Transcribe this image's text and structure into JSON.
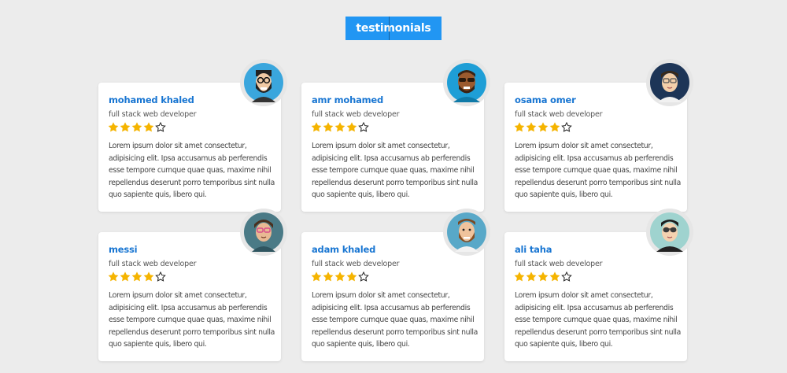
{
  "section_title": "testimonials",
  "star_color": "#f5b400",
  "accent_color": "#2196f3",
  "testimonials": [
    {
      "name": "mohamed khaled",
      "role": "full stack web developer",
      "rating": 4,
      "max_rating": 5,
      "avatar_icon": "avatar-beard-glasses-icon",
      "text": "Lorem ipsum dolor sit amet consectetur, adipisicing elit. Ipsa accusamus ab perferendis esse tempore cumque quae quas, maxime nihil repellendus deserunt porro temporibus sint nulla quo sapiente quis, libero qui."
    },
    {
      "name": "amr mohamed",
      "role": "full stack web developer",
      "rating": 4,
      "max_rating": 5,
      "avatar_icon": "avatar-sunglasses-icon",
      "text": "Lorem ipsum dolor sit amet consectetur, adipisicing elit. Ipsa accusamus ab perferendis esse tempore cumque quae quas, maxime nihil repellendus deserunt porro temporibus sint nulla quo sapiente quis, libero qui."
    },
    {
      "name": "osama omer",
      "role": "full stack web developer",
      "rating": 4,
      "max_rating": 5,
      "avatar_icon": "avatar-glasses-icon",
      "text": "Lorem ipsum dolor sit amet consectetur, adipisicing elit. Ipsa accusamus ab perferendis esse tempore cumque quae quas, maxime nihil repellendus deserunt porro temporibus sint nulla quo sapiente quis, libero qui."
    },
    {
      "name": "messi",
      "role": "full stack web developer",
      "rating": 4,
      "max_rating": 5,
      "avatar_icon": "avatar-pink-glasses-icon",
      "text": "Lorem ipsum dolor sit amet consectetur, adipisicing elit. Ipsa accusamus ab perferendis esse tempore cumque quae quas, maxime nihil repellendus deserunt porro temporibus sint nulla quo sapiente quis, libero qui."
    },
    {
      "name": "adam khaled",
      "role": "full stack web developer",
      "rating": 4,
      "max_rating": 5,
      "avatar_icon": "avatar-ginger-beard-icon",
      "text": "Lorem ipsum dolor sit amet consectetur, adipisicing elit. Ipsa accusamus ab perferendis esse tempore cumque quae quas, maxime nihil repellendus deserunt porro temporibus sint nulla quo sapiente quis, libero qui."
    },
    {
      "name": "ali taha",
      "role": "full stack web developer",
      "rating": 4,
      "max_rating": 5,
      "avatar_icon": "avatar-aviator-glasses-icon",
      "text": "Lorem ipsum dolor sit amet consectetur, adipisicing elit. Ipsa accusamus ab perferendis esse tempore cumque quae quas, maxime nihil repellendus deserunt porro temporibus sint nulla quo sapiente quis, libero qui."
    }
  ]
}
